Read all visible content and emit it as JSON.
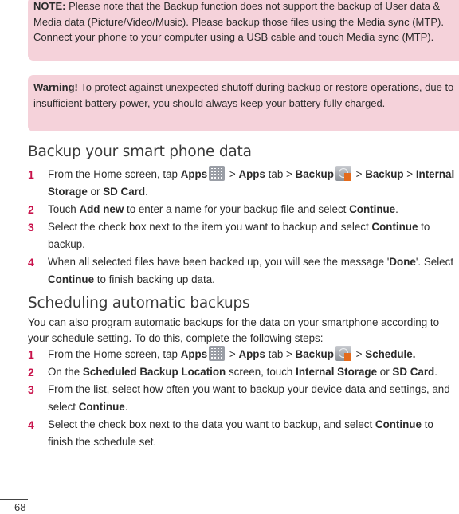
{
  "note": {
    "label": "NOTE:",
    "text": " Please note that the Backup function does not support the backup of User data & Media data (Picture/Video/Music). Please backup those files using the Media sync (MTP). Connect your phone to your computer using a USB cable and touch Media sync (MTP)."
  },
  "warning": {
    "label": "Warning!",
    "text": " To protect against unexpected shutoff during backup or restore operations, due to insufficient battery power, you should always keep your battery fully charged."
  },
  "section1": {
    "title": "Backup your smart phone data",
    "steps": [
      {
        "num": "1",
        "parts": [
          {
            "t": "From the Home screen, tap "
          },
          {
            "t": "Apps",
            "b": true
          },
          {
            "icon": "apps-grid-icon"
          },
          {
            "t": " > "
          },
          {
            "t": "Apps",
            "b": true
          },
          {
            "t": " tab > "
          },
          {
            "t": "Backup",
            "b": true
          },
          {
            "icon": "backup-app-icon"
          },
          {
            "t": " > "
          },
          {
            "t": "Backup",
            "b": true
          },
          {
            "t": " > "
          },
          {
            "t": "Internal Storage",
            "b": true
          },
          {
            "t": " or "
          },
          {
            "t": "SD Card",
            "b": true
          },
          {
            "t": "."
          }
        ]
      },
      {
        "num": "2",
        "parts": [
          {
            "t": "Touch "
          },
          {
            "t": "Add new",
            "b": true
          },
          {
            "t": " to enter a name for your backup file and select "
          },
          {
            "t": "Continue",
            "b": true
          },
          {
            "t": "."
          }
        ]
      },
      {
        "num": "3",
        "parts": [
          {
            "t": "Select the check box next to the item you want to backup and select "
          },
          {
            "t": "Continue",
            "b": true
          },
          {
            "t": " to backup."
          }
        ]
      },
      {
        "num": "4",
        "parts": [
          {
            "t": "When all selected files have been backed up, you will see the message '"
          },
          {
            "t": "Done",
            "b": true
          },
          {
            "t": "'. Select "
          },
          {
            "t": "Continue",
            "b": true
          },
          {
            "t": " to finish backing up data."
          }
        ]
      }
    ]
  },
  "section2": {
    "title": "Scheduling automatic backups",
    "intro": "You can also program automatic backups for the data on your smartphone according to your schedule setting. To do this, complete the following steps:",
    "steps": [
      {
        "num": "1",
        "parts": [
          {
            "t": "From the Home screen, tap "
          },
          {
            "t": "Apps",
            "b": true
          },
          {
            "icon": "apps-grid-icon"
          },
          {
            "t": " > "
          },
          {
            "t": "Apps",
            "b": true
          },
          {
            "t": " tab > "
          },
          {
            "t": "Backup",
            "b": true
          },
          {
            "icon": "backup-app-icon"
          },
          {
            "t": " > "
          },
          {
            "t": "Schedule.",
            "b": true
          }
        ]
      },
      {
        "num": "2",
        "parts": [
          {
            "t": "On the "
          },
          {
            "t": "Scheduled Backup Location",
            "b": true
          },
          {
            "t": " screen, touch "
          },
          {
            "t": "Internal Storage",
            "b": true
          },
          {
            "t": " or "
          },
          {
            "t": "SD Card",
            "b": true
          },
          {
            "t": "."
          }
        ]
      },
      {
        "num": "3",
        "parts": [
          {
            "t": "From the list, select how often you want to backup your device data and settings, and select "
          },
          {
            "t": "Continue",
            "b": true
          },
          {
            "t": "."
          }
        ]
      },
      {
        "num": "4",
        "parts": [
          {
            "t": "Select the check box next to the data you want to backup, and select "
          },
          {
            "t": "Continue",
            "b": true
          },
          {
            "t": " to finish the schedule set."
          }
        ]
      }
    ]
  },
  "colors": {
    "note_bg": "#f5d2da",
    "step_number": "#c8134b",
    "backup_icon_accent": "#e46b1c"
  },
  "page_number": "68"
}
